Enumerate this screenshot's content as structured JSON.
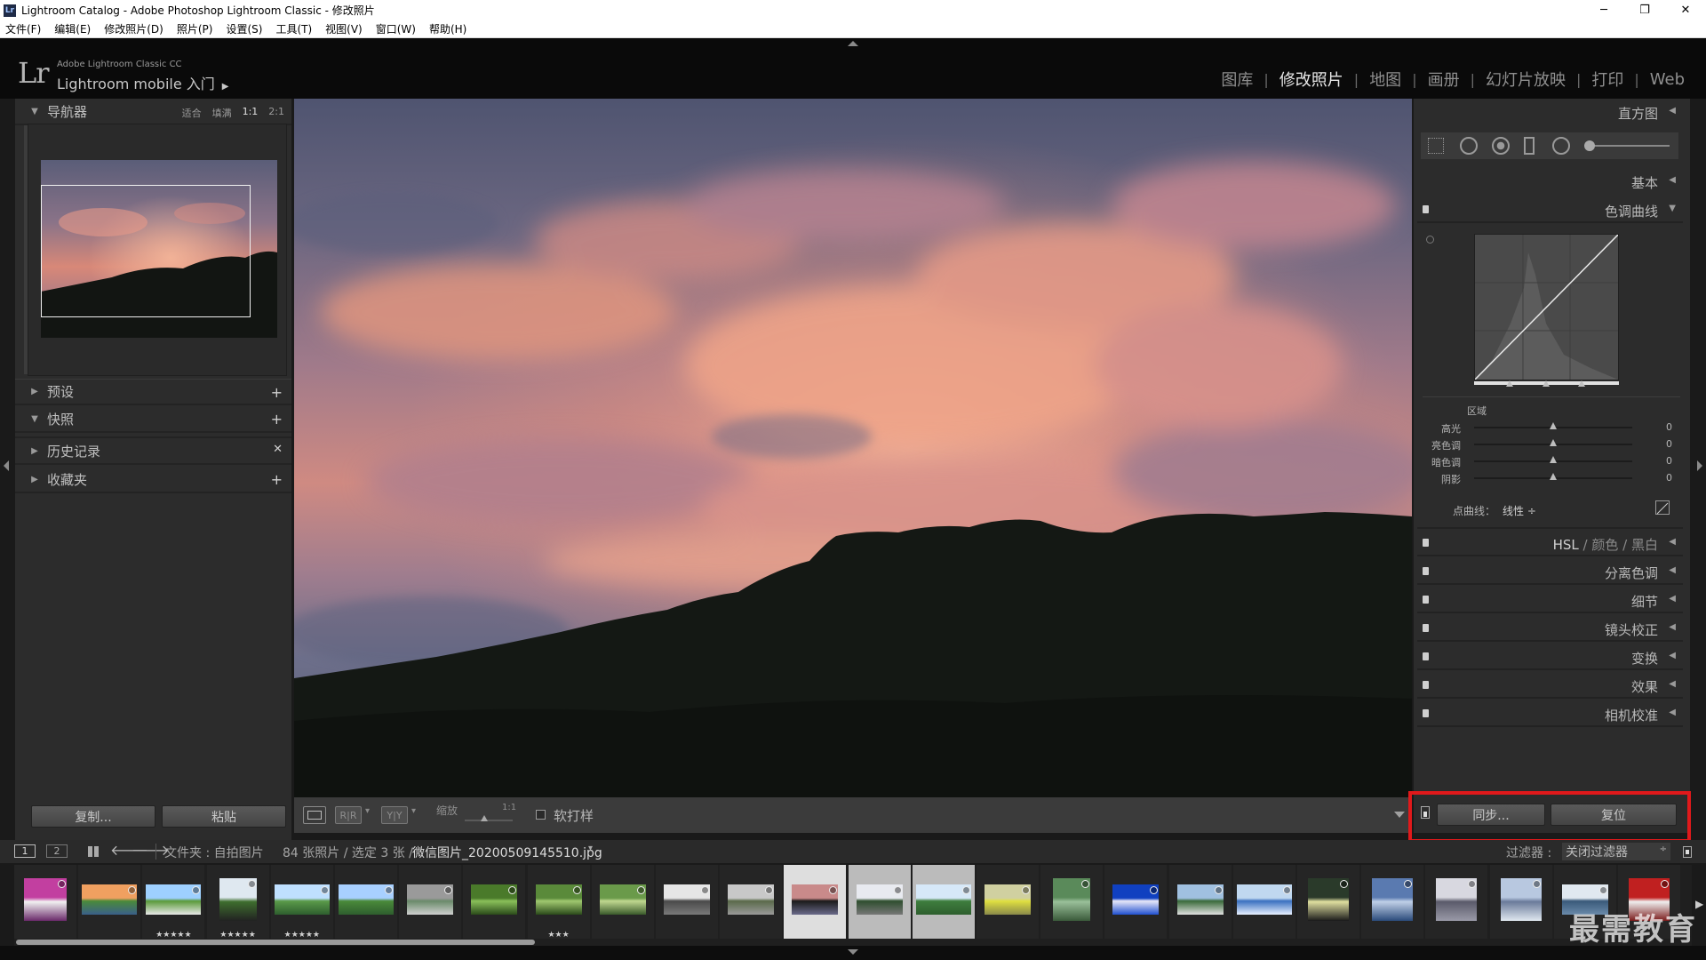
{
  "window": {
    "title": "Lightroom Catalog - Adobe Photoshop Lightroom Classic - 修改照片",
    "app_icon_text": "Lr",
    "controls": [
      "─",
      "❐",
      "✕"
    ]
  },
  "menu": [
    "文件(F)",
    "编辑(E)",
    "修改照片(D)",
    "照片(P)",
    "设置(S)",
    "工具(T)",
    "视图(V)",
    "窗口(W)",
    "帮助(H)"
  ],
  "identity": {
    "logo": "Lr",
    "edition": "Adobe Lightroom Classic CC",
    "mobile": "Lightroom mobile 入门",
    "mobile_arrow": "▶"
  },
  "modules": [
    {
      "label": "图库",
      "active": false
    },
    {
      "label": "修改照片",
      "active": true
    },
    {
      "label": "地图",
      "active": false
    },
    {
      "label": "画册",
      "active": false
    },
    {
      "label": "幻灯片放映",
      "active": false
    },
    {
      "label": "打印",
      "active": false
    },
    {
      "label": "Web",
      "active": false
    }
  ],
  "left_panel": {
    "navigator": {
      "title": "导航器",
      "zoom": [
        "适合",
        "填满",
        "1:1",
        "2:1"
      ],
      "zoom_active": "1:1"
    },
    "sections": [
      {
        "title": "预设",
        "action": "+",
        "expanded": false
      },
      {
        "title": "快照",
        "action": "+",
        "expanded": true
      },
      {
        "title": "历史记录",
        "action": "✕",
        "expanded": false
      },
      {
        "title": "收藏夹",
        "action": "+",
        "expanded": false
      }
    ],
    "copy_button": "复制...",
    "paste_button": "粘贴"
  },
  "toolbar": {
    "zoom_label": "缩放",
    "zoom_value": "1:1",
    "softproof_label": "软打样"
  },
  "right_panel": {
    "histogram": "直方图",
    "basic": "基本",
    "tone_curve": "色调曲线",
    "region_label": "区域",
    "regions": [
      {
        "name": "高光",
        "value": "0"
      },
      {
        "name": "亮色调",
        "value": "0"
      },
      {
        "name": "暗色调",
        "value": "0"
      },
      {
        "name": "阴影",
        "value": "0"
      }
    ],
    "point_curve_label": "点曲线：",
    "point_curve_value": "线性 ÷",
    "hsl": [
      "HSL",
      "颜色",
      "黑白"
    ],
    "sections": [
      "分离色调",
      "细节",
      "镜头校正",
      "变换",
      "效果",
      "相机校准"
    ],
    "sync_button": "同步...",
    "reset_button": "复位"
  },
  "filmstrip": {
    "pages": [
      "1",
      "2"
    ],
    "source": "文件夹 : 自拍图片",
    "count": "84 张照片 / 选定 3 张 /",
    "filename": "微信图片_20200509145510.jpg",
    "filter_label": "过滤器 :",
    "filter_value": "关闭过滤器",
    "star_ratings": [
      "",
      "",
      "★★★★★",
      "★★★★★",
      "★★★★★",
      "",
      "",
      "",
      "★★★",
      "",
      "",
      "",
      "",
      "",
      "",
      "",
      "",
      "",
      "",
      "",
      "",
      "",
      "",
      "",
      "",
      ""
    ]
  },
  "watermark": "最需教育",
  "colors": {
    "highlight": "#e0191b",
    "sky_pink": "#e8927e",
    "sky_blue": "#6a6f88"
  }
}
